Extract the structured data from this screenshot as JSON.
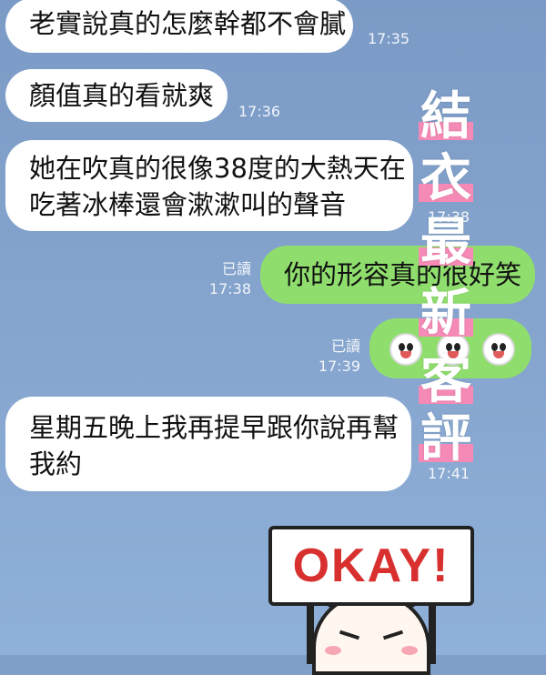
{
  "messages": [
    {
      "text_lines": [
        "老實說真的怎麼幹都不會膩"
      ],
      "time": "17:35"
    },
    {
      "text_lines": [
        "顏值真的看就爽"
      ],
      "time": "17:36"
    },
    {
      "text_lines": [
        "她在吹真的很像38度的大熱天在",
        "吃著冰棒還會漱漱叫的聲音"
      ],
      "time": "17:38"
    },
    {
      "text_lines": [
        "你的形容真的很好笑"
      ],
      "read": "已讀",
      "time": "17:38"
    },
    {
      "read": "已讀",
      "time": "17:39",
      "emoji_icons": [
        "laughing-face-icon",
        "laughing-face-icon",
        "laughing-face-icon"
      ]
    },
    {
      "text_lines": [
        "星期五晚上我再提早跟你說再幫",
        "我約"
      ],
      "time": "17:41"
    }
  ],
  "overlay_chars": [
    "結",
    "衣",
    "最",
    "新",
    "客",
    "評"
  ],
  "sticker": {
    "sign_text": "OKAY!"
  },
  "colors": {
    "incoming": "#ffffff",
    "outgoing": "#8fde6d",
    "highlight": "#f58ab6",
    "sign_text": "#d8302f"
  }
}
